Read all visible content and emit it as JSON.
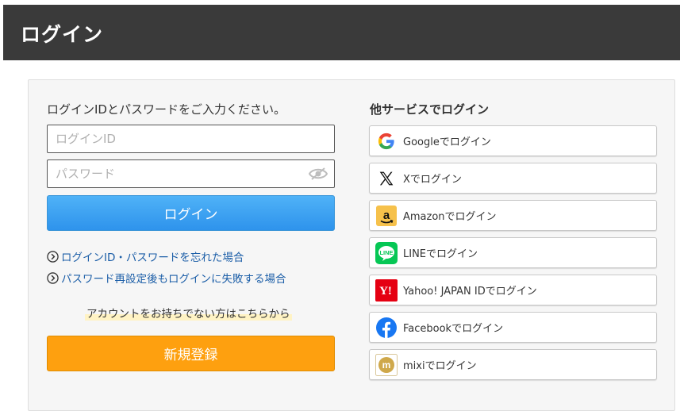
{
  "header": {
    "title": "ログイン"
  },
  "login": {
    "intro": "ログインIDとパスワードをご入力ください。",
    "id_placeholder": "ログインID",
    "password_placeholder": "パスワード",
    "login_button": "ログイン",
    "forgot_link": "ログインID・パスワードを忘れた場合",
    "reset_fail_link": "パスワード再設定後もログインに失敗する場合",
    "no_account_text": "アカウントをお持ちでない方はこちらから",
    "register_button": "新規登録"
  },
  "sso": {
    "heading": "他サービスでログイン",
    "providers": [
      {
        "label": "Googleでログイン",
        "icon": "google-icon"
      },
      {
        "label": "Xでログイン",
        "icon": "x-icon"
      },
      {
        "label": "Amazonでログイン",
        "icon": "amazon-icon"
      },
      {
        "label": "LINEでログイン",
        "icon": "line-icon"
      },
      {
        "label": "Yahoo! JAPAN IDでログイン",
        "icon": "yahoo-japan-icon"
      },
      {
        "label": "Facebookでログイン",
        "icon": "facebook-icon"
      },
      {
        "label": "mixiでログイン",
        "icon": "mixi-icon"
      }
    ]
  },
  "colors": {
    "header_bg": "#3a3a3a",
    "login_button": "#3aa0f2",
    "register_button": "#fea00f",
    "link": "#1d5fa8"
  }
}
